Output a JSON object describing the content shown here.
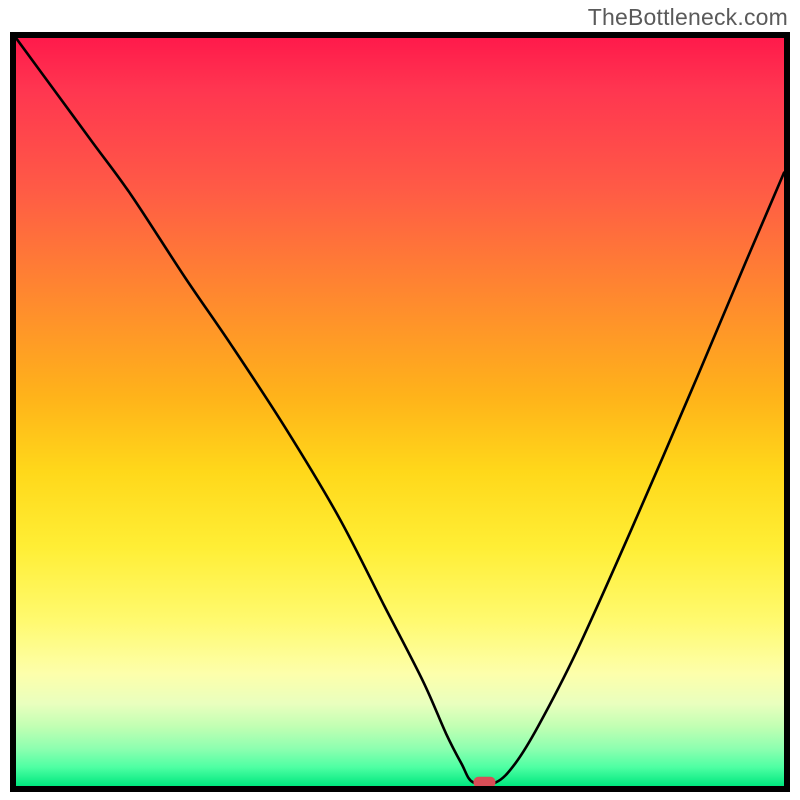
{
  "branding": {
    "watermark": "TheBottleneck.com"
  },
  "chart_data": {
    "type": "line",
    "title": "",
    "xlabel": "",
    "ylabel": "",
    "xlim": [
      0,
      100
    ],
    "ylim": [
      0,
      100
    ],
    "grid": false,
    "legend": false,
    "series": [
      {
        "name": "bottleneck-curve",
        "x": [
          0,
          5,
          10,
          15,
          22,
          28,
          35,
          42,
          48,
          53,
          56,
          58,
          59.5,
          62.5,
          65,
          68,
          73,
          80,
          88,
          95,
          100
        ],
        "values": [
          100,
          93,
          86,
          79,
          68,
          59,
          48,
          36,
          24,
          14,
          7,
          3,
          0.5,
          0.5,
          3,
          8,
          18,
          34,
          53,
          70,
          82
        ]
      }
    ],
    "marker": {
      "x": 61,
      "y": 0.5
    },
    "background_gradient": {
      "top": "#ff1a4b",
      "mid": "#ffd81a",
      "bottom": "#00e87e"
    }
  }
}
